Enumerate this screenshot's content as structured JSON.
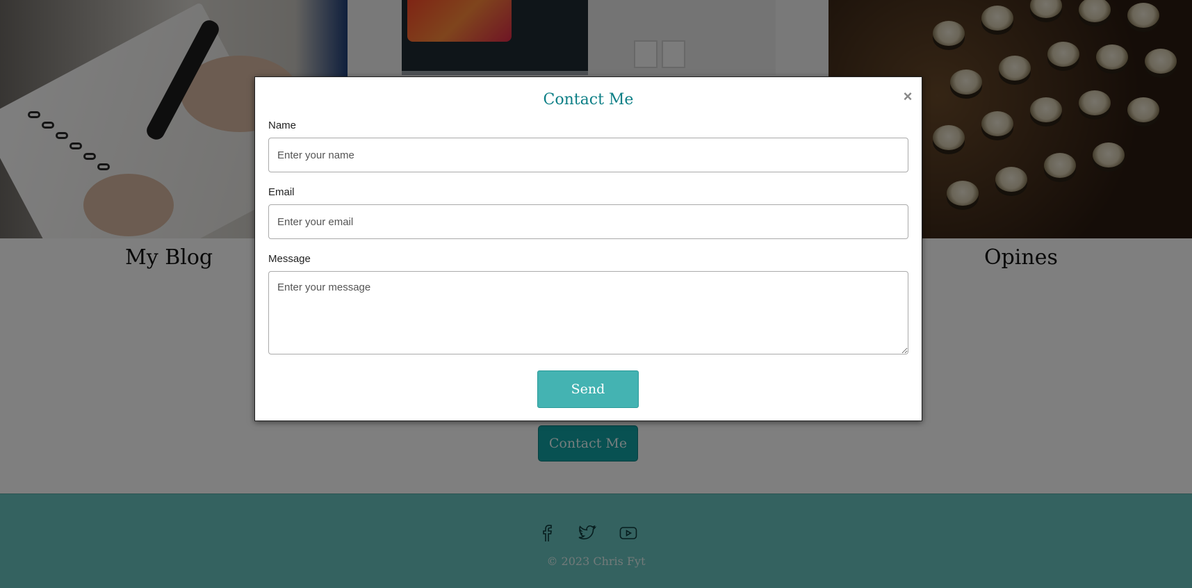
{
  "page": {
    "sections": [
      {
        "title": "My Blog"
      },
      {
        "title": "Opines"
      }
    ],
    "contact_button": "Contact Me",
    "footer": {
      "social_icons": [
        "facebook-icon",
        "twitter-icon",
        "youtube-icon"
      ],
      "copyright": "© 2023 Chris Fyt"
    },
    "colors": {
      "accent": "#10a2a4",
      "footer": "#68c4c1",
      "modal_title": "#0d7f86",
      "send_button": "#44b3b2"
    }
  },
  "modal": {
    "title": "Contact Me",
    "close_symbol": "×",
    "name_label": "Name",
    "name_placeholder": "Enter your name",
    "email_label": "Email",
    "email_placeholder": "Enter your email",
    "message_label": "Message",
    "message_placeholder": "Enter your message",
    "send_label": "Send"
  }
}
